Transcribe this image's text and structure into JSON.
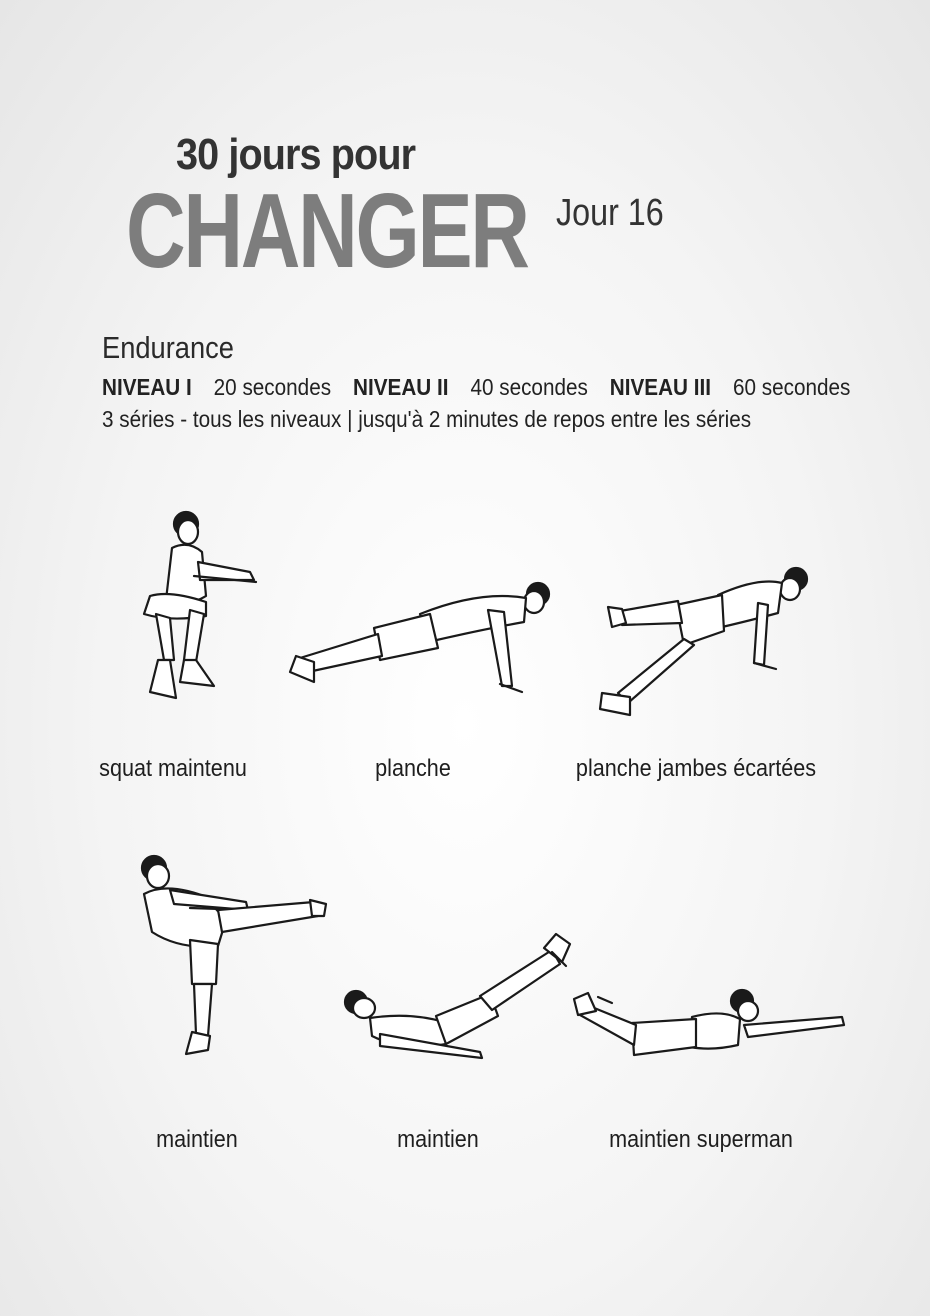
{
  "header": {
    "title_top": "30 jours pour",
    "title_main": "CHANGER",
    "day": "Jour 16"
  },
  "workout": {
    "category": "Endurance",
    "levels": [
      {
        "name": "NIVEAU I",
        "duration": "20 secondes"
      },
      {
        "name": "NIVEAU II",
        "duration": "40 secondes"
      },
      {
        "name": "NIVEAU III",
        "duration": "60 secondes"
      }
    ],
    "series_info": "3 séries  -  tous les niveaux | jusqu'à 2 minutes de repos entre les séries"
  },
  "exercises": [
    {
      "label": "squat maintenu",
      "figure": "wall-squat-figure"
    },
    {
      "label": "planche",
      "figure": "plank-figure"
    },
    {
      "label": "planche jambes écartées",
      "figure": "plank-leg-raise-figure"
    },
    {
      "label": "maintien",
      "figure": "side-kick-hold-figure"
    },
    {
      "label": "maintien",
      "figure": "v-hold-figure"
    },
    {
      "label": "maintien superman",
      "figure": "superman-figure"
    }
  ],
  "colors": {
    "title_top": "#333333",
    "title_main": "#7d7d7d",
    "text": "#1c1c1c"
  }
}
